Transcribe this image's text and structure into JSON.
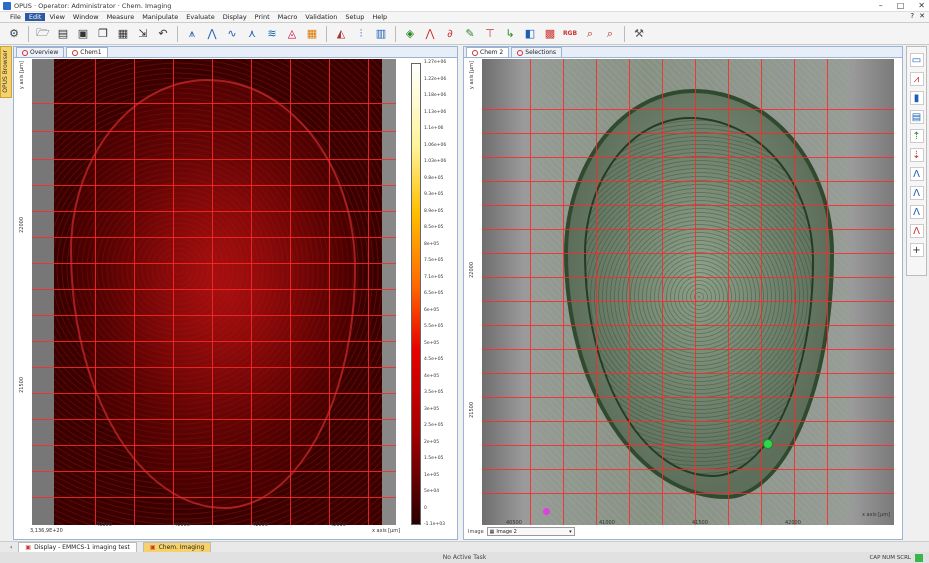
{
  "window": {
    "title": "OPUS · Operator: Administrator · Chem. Imaging",
    "controls": [
      "–",
      "□",
      "✕"
    ]
  },
  "menu": {
    "items": [
      "File",
      "Edit",
      "View",
      "Window",
      "Measure",
      "Manipulate",
      "Evaluate",
      "Display",
      "Print",
      "Macro",
      "Validation",
      "Setup",
      "Help"
    ],
    "active_index": 1,
    "right_icons": [
      "?",
      "✕"
    ]
  },
  "toolbar": {
    "icons": [
      "gear-icon",
      "folder-open-icon",
      "folder-icon",
      "save-icon",
      "copy-icon",
      "save-as-icon",
      "import-icon",
      "undo-icon",
      "peak-pick-icon",
      "baseline-icon",
      "smooth-icon",
      "peaks-icon",
      "spectrum-icon",
      "atr-icon",
      "grid-icon",
      "map-icon",
      "chart-icon",
      "table-icon",
      "layers-icon",
      "line-fit-icon",
      "derivative-icon",
      "spectra-icon",
      "filter-icon",
      "rgb-stack-icon",
      "compare-icon",
      "heat-icon",
      "rgb-icon",
      "zoom-in-icon",
      "zoom-out-icon",
      "tool-icon"
    ],
    "rgb_label": "RGB"
  },
  "left_tab": {
    "label": "OPUS Browser"
  },
  "left_pane": {
    "tabs": [
      {
        "label": "Overview"
      },
      {
        "label": "Chem1"
      }
    ],
    "y_axis_label": "y axis [µm]",
    "y_ticks": [
      "22000",
      "21500"
    ],
    "x_axis_label": "x axis [µm]",
    "x_ticks": [
      "40500",
      "41000",
      "41500",
      "42000"
    ],
    "x_min_label": "3,136,9E+20",
    "colorbar_ticks": [
      "1.27e+06",
      "1.22e+06",
      "1.18e+06",
      "1.13e+06",
      "1.1e+06",
      "1.06e+06",
      "1.03e+06",
      "9.8e+05",
      "9.3e+05",
      "8.9e+05",
      "8.5e+05",
      "8e+05",
      "7.5e+05",
      "7.1e+05",
      "6.5e+05",
      "6e+05",
      "5.5e+05",
      "5e+05",
      "4.5e+05",
      "4e+05",
      "3.5e+05",
      "3e+05",
      "2.5e+05",
      "2e+05",
      "1.5e+05",
      "1e+05",
      "5e+04",
      "0",
      "-1.1e+03"
    ]
  },
  "right_pane": {
    "tabs": [
      {
        "label": "Chem 2"
      },
      {
        "label": "Selections"
      }
    ],
    "y_axis_label": "y axis [µm]",
    "y_ticks": [
      "22000",
      "21500"
    ],
    "x_axis_label": "x axis [µm]",
    "x_ticks": [
      "40500",
      "41000",
      "41500",
      "42000"
    ],
    "image_selector_label": "Image",
    "image_selector_value": "Image 2"
  },
  "right_sidebar": {
    "icons": [
      "spectrum-view-icon",
      "absorbance-icon",
      "bar-chart-icon",
      "table-view-icon",
      "peak-up-icon",
      "peak-down-icon",
      "lambda-icon",
      "lambda-icon",
      "lambda-icon",
      "lambda-red-icon",
      "cross-icon"
    ]
  },
  "bottom_tabs": [
    {
      "label": "Display - EMMCS-1 imaging test"
    },
    {
      "label": "Chem. Imaging"
    }
  ],
  "status": {
    "center": "No Active Task",
    "right": "CAP NUM SCRL"
  }
}
